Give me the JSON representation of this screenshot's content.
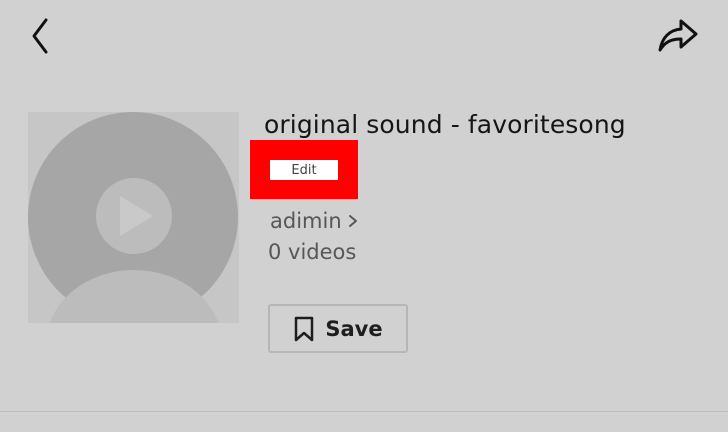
{
  "header": {
    "back_icon": "chevron-left-icon",
    "share_icon": "share-arrow-icon"
  },
  "sound": {
    "title": "original sound - favoritesong",
    "edit_label": "Edit",
    "author": "adimin",
    "video_count": "0 videos",
    "cover_icon": "default-avatar-with-play-icon"
  },
  "actions": {
    "save_label": "Save",
    "save_icon": "bookmark-icon"
  },
  "colors": {
    "background": "#d1d1d1",
    "highlight": "#ff0000",
    "text_primary": "#151515",
    "text_secondary": "#575757"
  }
}
